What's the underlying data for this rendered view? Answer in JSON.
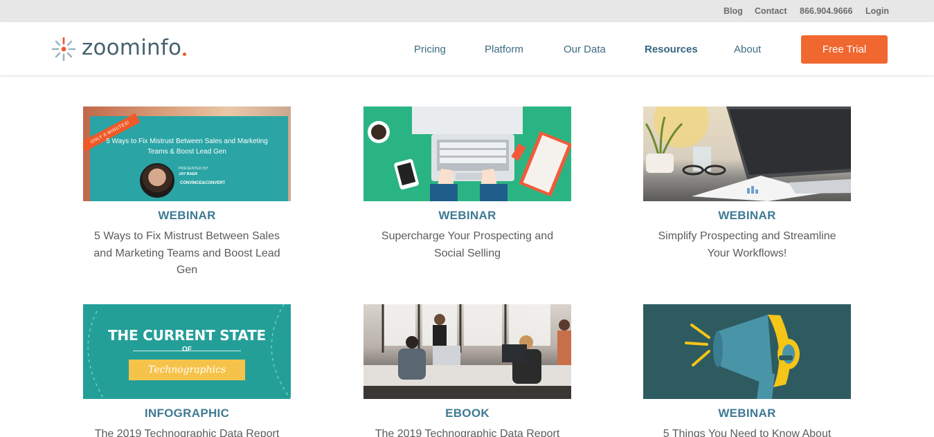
{
  "utility_bar": {
    "blog": "Blog",
    "contact": "Contact",
    "phone": "866.904.9666",
    "login": "Login"
  },
  "header": {
    "logo_text": "zoominfo",
    "nav": {
      "pricing": "Pricing",
      "platform": "Platform",
      "our_data": "Our Data",
      "resources": "Resources",
      "about": "About"
    },
    "cta": "Free Trial"
  },
  "colors": {
    "accent": "#f0672f",
    "nav_text": "#3d6b82",
    "category_text": "#3f7a94"
  },
  "cards": [
    {
      "category": "WEBINAR",
      "title": "5 Ways to Fix Mistrust Between Sales and Marketing Teams and Boost Lead Gen",
      "thumb": {
        "ribbon": "ONLY 8 MINUTES!",
        "headline": "5 Ways to Fix Mistrust Between Sales and Marketing Teams & Boost Lead Gen",
        "presented_by": "PRESENTED BY:",
        "presenter": "JAY BAER",
        "brand": "CONVINCE&CONVERT"
      }
    },
    {
      "category": "WEBINAR",
      "title": "Supercharge Your Prospecting and Social Selling"
    },
    {
      "category": "WEBINAR",
      "title": "Simplify Prospecting and Streamline Your Workflows!"
    },
    {
      "category": "INFOGRAPHIC",
      "title": "The 2019 Technographic Data Report",
      "thumb": {
        "headline": "THE CURRENT STATE",
        "of": "OF",
        "banner": "Technographics"
      }
    },
    {
      "category": "EBOOK",
      "title": "The 2019 Technographic Data Report"
    },
    {
      "category": "WEBINAR",
      "title": "5 Things You Need to Know About"
    }
  ]
}
